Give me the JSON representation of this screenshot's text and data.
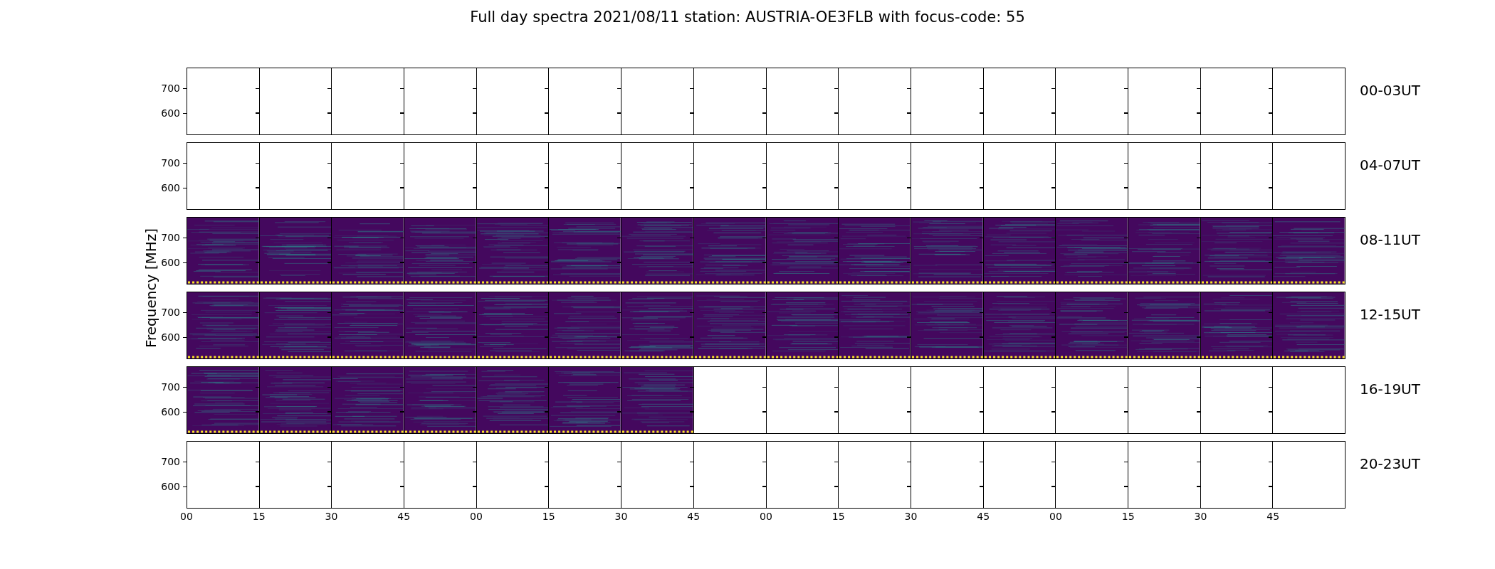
{
  "title": "Full day spectra 2021/08/11 station: AUSTRIA-OE3FLB with focus-code: 55",
  "ylabel": "Frequency [MHz]",
  "rows": [
    {
      "label": "00-03UT",
      "yticks": [
        "700",
        "600"
      ],
      "panels": [
        false,
        false,
        false,
        false,
        false,
        false,
        false,
        false,
        false,
        false,
        false,
        false,
        false,
        false,
        false,
        false
      ]
    },
    {
      "label": "04-07UT",
      "yticks": [
        "700",
        "600"
      ],
      "panels": [
        false,
        false,
        false,
        false,
        false,
        false,
        false,
        false,
        false,
        false,
        false,
        false,
        false,
        false,
        false,
        false
      ]
    },
    {
      "label": "08-11UT",
      "yticks": [
        "700",
        "600"
      ],
      "panels": [
        true,
        true,
        true,
        true,
        true,
        true,
        true,
        true,
        true,
        true,
        true,
        true,
        true,
        true,
        true,
        true
      ]
    },
    {
      "label": "12-15UT",
      "yticks": [
        "700",
        "600"
      ],
      "panels": [
        true,
        true,
        true,
        true,
        true,
        true,
        true,
        true,
        true,
        true,
        true,
        true,
        true,
        true,
        true,
        true
      ]
    },
    {
      "label": "16-19UT",
      "yticks": [
        "700",
        "600"
      ],
      "panels": [
        true,
        true,
        true,
        true,
        true,
        true,
        true,
        false,
        false,
        false,
        false,
        false,
        false,
        false,
        false,
        false
      ]
    },
    {
      "label": "20-23UT",
      "yticks": [
        "700",
        "600"
      ],
      "panels": [
        false,
        false,
        false,
        false,
        false,
        false,
        false,
        false,
        false,
        false,
        false,
        false,
        false,
        false,
        false,
        false
      ]
    }
  ],
  "xticks": [
    "00",
    "15",
    "30",
    "45",
    "00",
    "15",
    "30",
    "45",
    "00",
    "15",
    "30",
    "45",
    "00",
    "15",
    "30",
    "45"
  ]
}
